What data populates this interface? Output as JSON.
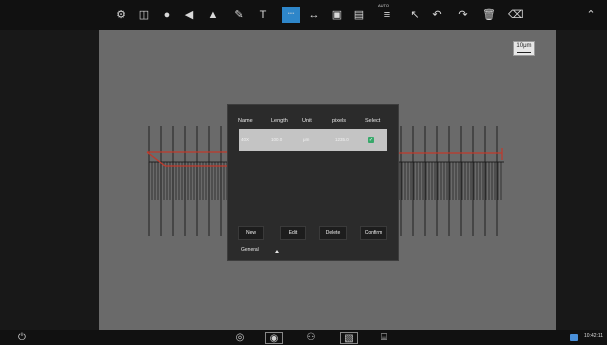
{
  "toolbar": {
    "tools": [
      {
        "icon": "settings-gear-icon",
        "glyph": "⚙"
      },
      {
        "icon": "compare-split-icon",
        "glyph": "◫"
      },
      {
        "icon": "color-wheel-icon",
        "glyph": "●"
      },
      {
        "icon": "triangle-left-icon",
        "glyph": "◀"
      },
      {
        "icon": "triangle-icon",
        "glyph": "▲"
      },
      {
        "icon": "pen-icon",
        "glyph": "✎"
      },
      {
        "icon": "text-tool-icon",
        "glyph": "T"
      },
      {
        "icon": "ruler-icon",
        "glyph": "┈"
      },
      {
        "icon": "measure-line-icon",
        "glyph": "↔"
      },
      {
        "icon": "image-icon",
        "glyph": "▣"
      },
      {
        "icon": "color-bars-icon",
        "glyph": "▤"
      },
      {
        "icon": "auto-icon",
        "glyph": "≡"
      },
      {
        "icon": "pointer-icon",
        "glyph": "↖"
      },
      {
        "icon": "undo-icon",
        "glyph": "↶"
      },
      {
        "icon": "redo-icon",
        "glyph": "↷"
      },
      {
        "icon": "delete-icon",
        "glyph": "🗑"
      },
      {
        "icon": "eraser-icon",
        "glyph": "⌫"
      }
    ],
    "collapse_glyph": "⌃",
    "auto_label": "AUTO"
  },
  "scalebar": {
    "label": "10μm"
  },
  "dialog": {
    "headers": {
      "name": "Name",
      "length": "Length",
      "unit": "Unit",
      "pixels": "pixels",
      "select": "Select"
    },
    "rows": [
      {
        "name": "40X",
        "length": "100.0",
        "unit": "μm",
        "pixels": "1235.0",
        "selected": true
      }
    ],
    "buttons": {
      "new": "New",
      "edit": "Edit",
      "delete": "Delete",
      "confirm": "Confirm"
    },
    "general": "General"
  },
  "bottombar": {
    "power_glyph": "⏻",
    "icons": [
      {
        "icon": "camera-icon",
        "glyph": "◎"
      },
      {
        "icon": "capture-icon",
        "glyph": "◉"
      },
      {
        "icon": "record-icon",
        "glyph": "⚇"
      },
      {
        "icon": "gallery-icon",
        "glyph": "▧"
      },
      {
        "icon": "folder-icon",
        "glyph": "⌸"
      }
    ],
    "time": "10:42:11"
  },
  "colors": {
    "accent": "#2e86c9",
    "viewer_bg": "#6a6a6a",
    "measure_line": "#c0392b",
    "checkbox": "#37a86a"
  }
}
